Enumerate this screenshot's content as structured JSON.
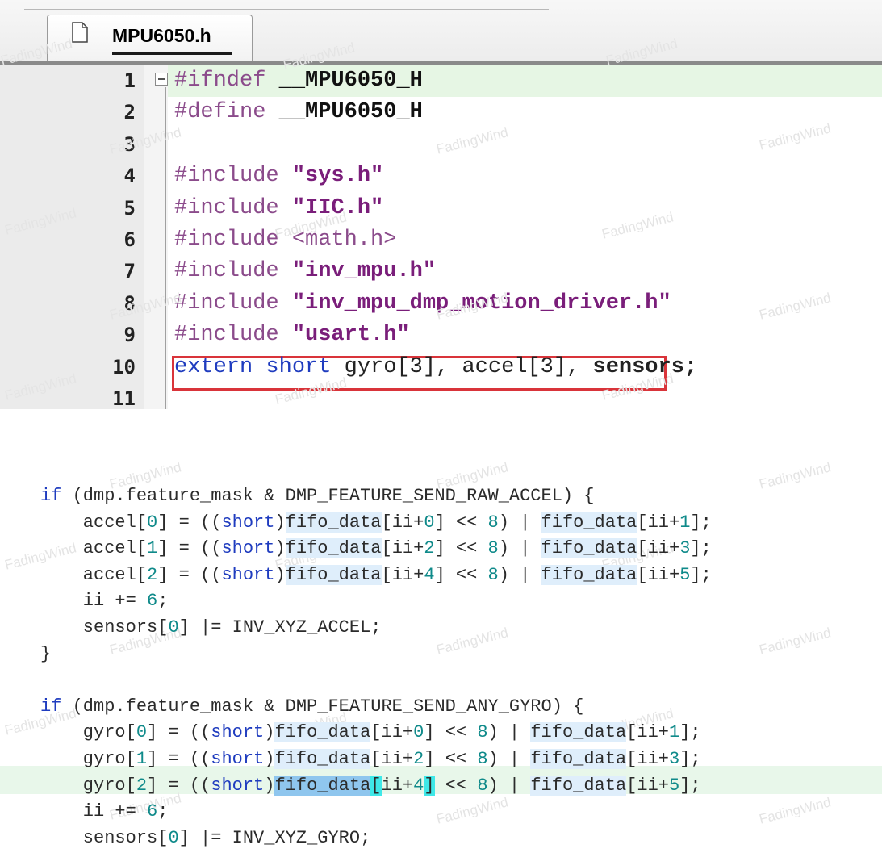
{
  "tab": {
    "filename": "MPU6050.h",
    "icon": "file-icon"
  },
  "editor": {
    "lines": [
      {
        "num": "1",
        "parts": [
          {
            "c": "pp",
            "t": "#ifndef "
          },
          {
            "c": "m",
            "t": "__MPU6050_H"
          }
        ]
      },
      {
        "num": "2",
        "parts": [
          {
            "c": "pp",
            "t": "#define "
          },
          {
            "c": "m",
            "t": "__MPU6050_H"
          }
        ]
      },
      {
        "num": "3",
        "parts": []
      },
      {
        "num": "4",
        "parts": [
          {
            "c": "pp",
            "t": "#include "
          },
          {
            "c": "st",
            "t": "\"sys.h\""
          }
        ]
      },
      {
        "num": "5",
        "parts": [
          {
            "c": "pp",
            "t": "#include "
          },
          {
            "c": "st",
            "t": "\"IIC.h\""
          }
        ]
      },
      {
        "num": "6",
        "parts": [
          {
            "c": "pp",
            "t": "#include "
          },
          {
            "c": "pp",
            "t": "<math.h>"
          }
        ]
      },
      {
        "num": "7",
        "parts": [
          {
            "c": "pp",
            "t": "#include "
          },
          {
            "c": "st",
            "t": "\"inv_mpu.h\""
          }
        ]
      },
      {
        "num": "8",
        "parts": [
          {
            "c": "pp",
            "t": "#include "
          },
          {
            "c": "st",
            "t": "\"inv_mpu_dmp_motion_driver.h\""
          }
        ]
      },
      {
        "num": "9",
        "parts": [
          {
            "c": "pp",
            "t": "#include "
          },
          {
            "c": "st",
            "t": "\"usart.h\""
          }
        ]
      },
      {
        "num": "10",
        "parts": [
          {
            "c": "kw",
            "t": "extern short "
          },
          {
            "c": "pl",
            "t": "gyro[3], accel[3], "
          },
          {
            "c": "pb",
            "t": "sensors;"
          }
        ]
      },
      {
        "num": "11",
        "parts": []
      }
    ]
  },
  "snippet": {
    "lines": [
      [
        {
          "c": "kw",
          "t": "if"
        },
        {
          "c": "",
          "t": " (dmp.feature_mask & DMP_FEATURE_SEND_RAW_ACCEL) {"
        }
      ],
      [
        {
          "c": "",
          "t": "    accel["
        },
        {
          "c": "num",
          "t": "0"
        },
        {
          "c": "",
          "t": "] = (("
        },
        {
          "c": "kw",
          "t": "short"
        },
        {
          "c": "",
          "t": ")"
        },
        {
          "c": "hl",
          "t": "fifo_data"
        },
        {
          "c": "",
          "t": "[ii+"
        },
        {
          "c": "num",
          "t": "0"
        },
        {
          "c": "",
          "t": "] << "
        },
        {
          "c": "num",
          "t": "8"
        },
        {
          "c": "",
          "t": ") | "
        },
        {
          "c": "hl",
          "t": "fifo_data"
        },
        {
          "c": "",
          "t": "[ii+"
        },
        {
          "c": "num",
          "t": "1"
        },
        {
          "c": "",
          "t": "];"
        }
      ],
      [
        {
          "c": "",
          "t": "    accel["
        },
        {
          "c": "num",
          "t": "1"
        },
        {
          "c": "",
          "t": "] = (("
        },
        {
          "c": "kw",
          "t": "short"
        },
        {
          "c": "",
          "t": ")"
        },
        {
          "c": "hl",
          "t": "fifo_data"
        },
        {
          "c": "",
          "t": "[ii+"
        },
        {
          "c": "num",
          "t": "2"
        },
        {
          "c": "",
          "t": "] << "
        },
        {
          "c": "num",
          "t": "8"
        },
        {
          "c": "",
          "t": ") | "
        },
        {
          "c": "hl",
          "t": "fifo_data"
        },
        {
          "c": "",
          "t": "[ii+"
        },
        {
          "c": "num",
          "t": "3"
        },
        {
          "c": "",
          "t": "];"
        }
      ],
      [
        {
          "c": "",
          "t": "    accel["
        },
        {
          "c": "num",
          "t": "2"
        },
        {
          "c": "",
          "t": "] = (("
        },
        {
          "c": "kw",
          "t": "short"
        },
        {
          "c": "",
          "t": ")"
        },
        {
          "c": "hl",
          "t": "fifo_data"
        },
        {
          "c": "",
          "t": "[ii+"
        },
        {
          "c": "num",
          "t": "4"
        },
        {
          "c": "",
          "t": "] << "
        },
        {
          "c": "num",
          "t": "8"
        },
        {
          "c": "",
          "t": ") | "
        },
        {
          "c": "hl",
          "t": "fifo_data"
        },
        {
          "c": "",
          "t": "[ii+"
        },
        {
          "c": "num",
          "t": "5"
        },
        {
          "c": "",
          "t": "];"
        }
      ],
      [
        {
          "c": "",
          "t": "    ii += "
        },
        {
          "c": "num",
          "t": "6"
        },
        {
          "c": "",
          "t": ";"
        }
      ],
      [
        {
          "c": "",
          "t": "    sensors["
        },
        {
          "c": "num",
          "t": "0"
        },
        {
          "c": "",
          "t": "] |= INV_XYZ_ACCEL;"
        }
      ],
      [
        {
          "c": "",
          "t": "}"
        }
      ],
      [],
      [
        {
          "c": "kw",
          "t": "if"
        },
        {
          "c": "",
          "t": " (dmp.feature_mask & DMP_FEATURE_SEND_ANY_GYRO) {"
        }
      ],
      [
        {
          "c": "",
          "t": "    gyro["
        },
        {
          "c": "num",
          "t": "0"
        },
        {
          "c": "",
          "t": "] = (("
        },
        {
          "c": "kw",
          "t": "short"
        },
        {
          "c": "",
          "t": ")"
        },
        {
          "c": "hl",
          "t": "fifo_data"
        },
        {
          "c": "",
          "t": "[ii+"
        },
        {
          "c": "num",
          "t": "0"
        },
        {
          "c": "",
          "t": "] << "
        },
        {
          "c": "num",
          "t": "8"
        },
        {
          "c": "",
          "t": ") | "
        },
        {
          "c": "hl",
          "t": "fifo_data"
        },
        {
          "c": "",
          "t": "[ii+"
        },
        {
          "c": "num",
          "t": "1"
        },
        {
          "c": "",
          "t": "];"
        }
      ],
      [
        {
          "c": "",
          "t": "    gyro["
        },
        {
          "c": "num",
          "t": "1"
        },
        {
          "c": "",
          "t": "] = (("
        },
        {
          "c": "kw",
          "t": "short"
        },
        {
          "c": "",
          "t": ")"
        },
        {
          "c": "hl",
          "t": "fifo_data"
        },
        {
          "c": "",
          "t": "[ii+"
        },
        {
          "c": "num",
          "t": "2"
        },
        {
          "c": "",
          "t": "] << "
        },
        {
          "c": "num",
          "t": "8"
        },
        {
          "c": "",
          "t": ") | "
        },
        {
          "c": "hl",
          "t": "fifo_data"
        },
        {
          "c": "",
          "t": "[ii+"
        },
        {
          "c": "num",
          "t": "3"
        },
        {
          "c": "",
          "t": "];"
        }
      ],
      [
        {
          "c": "",
          "t": "    gyro["
        },
        {
          "c": "num",
          "t": "2"
        },
        {
          "c": "",
          "t": "] = (("
        },
        {
          "c": "kw",
          "t": "short"
        },
        {
          "c": "",
          "t": ")"
        },
        {
          "c": "hl2",
          "t": "fifo_data"
        },
        {
          "c": "hlc",
          "t": "["
        },
        {
          "c": "",
          "t": "ii+"
        },
        {
          "c": "num",
          "t": "4"
        },
        {
          "c": "hlc",
          "t": "]"
        },
        {
          "c": "",
          "t": " << "
        },
        {
          "c": "num",
          "t": "8"
        },
        {
          "c": "",
          "t": ") | "
        },
        {
          "c": "hl",
          "t": "fifo_data"
        },
        {
          "c": "",
          "t": "[ii+"
        },
        {
          "c": "num",
          "t": "5"
        },
        {
          "c": "",
          "t": "];"
        }
      ],
      [
        {
          "c": "",
          "t": "    ii += "
        },
        {
          "c": "num",
          "t": "6"
        },
        {
          "c": "",
          "t": ";"
        }
      ],
      [
        {
          "c": "",
          "t": "    sensors["
        },
        {
          "c": "num",
          "t": "0"
        },
        {
          "c": "",
          "t": "] |= INV_XYZ_GYRO;"
        }
      ]
    ]
  },
  "watermark": "FadingWind",
  "colors": {
    "keyword": "#1f3cbf",
    "preprocessor": "#8b4b8b",
    "string": "#7a1e7a",
    "number": "#0f8a8a",
    "annotation_box": "#d9343a",
    "current_line": "#e6f6e4"
  }
}
